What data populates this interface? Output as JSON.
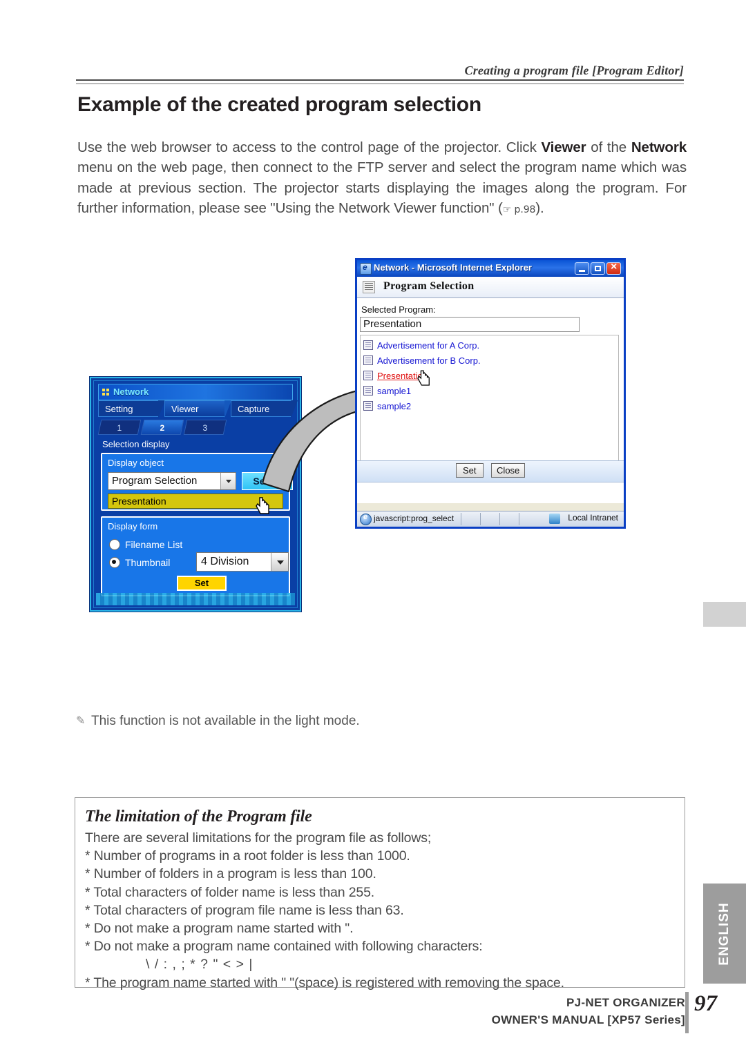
{
  "page": {
    "running_head": "Creating a program file [Program Editor]",
    "section_title": "Example of the created program selection",
    "intro_part1": "Use the web browser to access to the control page of the projector. Click ",
    "intro_bold1": "Viewer",
    "intro_part2": " of the ",
    "intro_bold2": "Network",
    "intro_part3": " menu on the web page, then connect to the FTP server and select the program name which was made at previous section. The projector starts displaying the images along the program. For further information, please see \"Using the Network Viewer function\" (",
    "intro_pageref": "☞ p.98",
    "intro_part4": ").",
    "note_icon": "pencil-icon",
    "note_text": "This function is not available in the light mode.",
    "page_number": "97",
    "language_tab": "ENGLISH",
    "footer_line1": "PJ-NET ORGANIZER",
    "footer_line2": "OWNER'S MANUAL [XP57 Series]"
  },
  "limitation_box": {
    "title": "The limitation of the Program file",
    "intro": "There are several limitations for the program file as follows;",
    "items": [
      "* Number of programs in a root folder is less than 1000.",
      "* Number of folders in a program is less than 100.",
      "* Total characters of folder name is less than 255.",
      "* Total characters of program file name is less than 63.",
      "* Do not make a program name started with \".",
      "* Do not make a program name contained with following characters:"
    ],
    "forbidden_chars": "\\ / : , ; * ? \" < > |",
    "last_item": "* The program name started with \" \"(space) is registered with removing the space."
  },
  "projector_panel": {
    "title": "Network",
    "title_icon": "grid-dots-icon",
    "main_tabs": [
      {
        "label": "Setting",
        "selected": false
      },
      {
        "label": "Viewer",
        "selected": true
      },
      {
        "label": "Capture",
        "selected": false
      }
    ],
    "sub_tabs": [
      {
        "label": "1",
        "selected": false
      },
      {
        "label": "2",
        "selected": true
      },
      {
        "label": "3",
        "selected": false
      }
    ],
    "section_label": "Selection display",
    "display_object": {
      "group_label": "Display object",
      "dropdown_value": "Program Selection",
      "select_button": "Select",
      "selected_program": "Presentation"
    },
    "display_form": {
      "group_label": "Display form",
      "options": [
        {
          "label": "Filename List",
          "selected": false
        },
        {
          "label": "Thumbnail",
          "selected": true
        }
      ],
      "division_value": "4 Division",
      "set_button": "Set"
    },
    "cursor_icon": "hand-pointer-icon"
  },
  "browser_window": {
    "title": "Network - Microsoft Internet Explorer",
    "title_icon": "ie-page-icon",
    "window_buttons": [
      "minimize-button",
      "maximize-button",
      "close-button"
    ],
    "page_header": "Program Selection",
    "page_header_icon": "list-icon",
    "selected_program_label": "Selected Program:",
    "selected_program_value": "Presentation",
    "file_list": [
      {
        "label": "Advertisement for A Corp.",
        "hovered": false
      },
      {
        "label": "Advertisement for B Corp.",
        "hovered": false
      },
      {
        "label": "Presentation",
        "hovered": true
      },
      {
        "label": "sample1",
        "hovered": false
      },
      {
        "label": "sample2",
        "hovered": false
      }
    ],
    "buttons": [
      {
        "label": "Set"
      },
      {
        "label": "Close"
      }
    ],
    "status_url": "javascript:prog_select",
    "status_zone": "Local Intranet",
    "status_zone_icon": "globe-icon"
  },
  "annotation": {
    "arrow_icon": "curved-arrow-icon",
    "arrow_color": "#bfbfbf"
  }
}
